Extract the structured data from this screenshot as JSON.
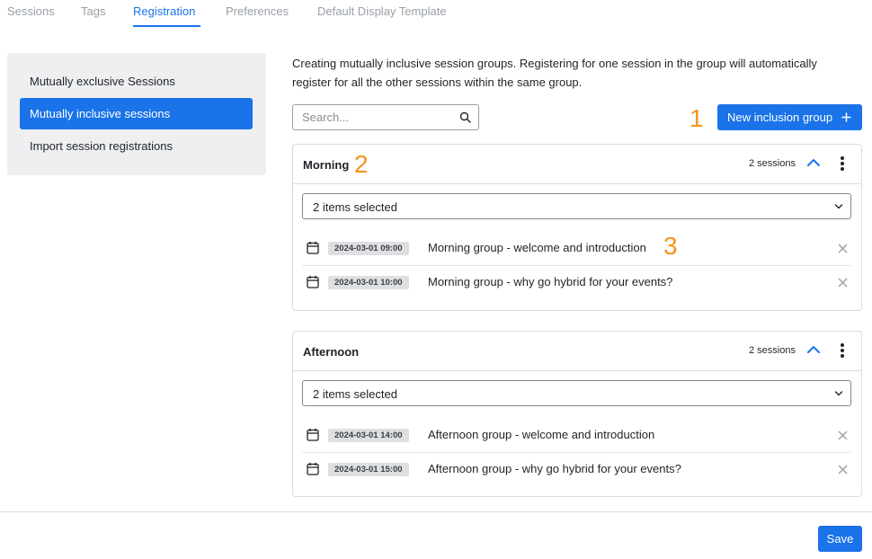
{
  "tabs": [
    {
      "label": "Sessions"
    },
    {
      "label": "Tags"
    },
    {
      "label": "Registration"
    },
    {
      "label": "Preferences"
    },
    {
      "label": "Default Display Template"
    }
  ],
  "active_tab": "Registration",
  "sidebar": {
    "items": [
      {
        "label": "Mutually exclusive Sessions"
      },
      {
        "label": "Mutually inclusive sessions"
      },
      {
        "label": "Import session registrations"
      }
    ],
    "active_item": "Mutually inclusive sessions"
  },
  "description": "Creating mutually inclusive session groups. Registering for one session in the group will automatically register for all the other sessions within the same group.",
  "search": {
    "placeholder": "Search...",
    "value": ""
  },
  "new_button_label": "New inclusion group",
  "annotations": [
    "1",
    "2",
    "3"
  ],
  "groups": [
    {
      "name": "Morning",
      "count_label": "2 sessions",
      "select_value": "2 items selected",
      "sessions": [
        {
          "date": "2024-03-01 09:00",
          "title": "Morning group - welcome and introduction"
        },
        {
          "date": "2024-03-01 10:00",
          "title": "Morning group - why go hybrid for your events?"
        }
      ]
    },
    {
      "name": "Afternoon",
      "count_label": "2 sessions",
      "select_value": "2 items selected",
      "sessions": [
        {
          "date": "2024-03-01 14:00",
          "title": "Afternoon group - welcome and introduction"
        },
        {
          "date": "2024-03-01 15:00",
          "title": "Afternoon group - why go hybrid for your events?"
        }
      ]
    }
  ],
  "save_label": "Save",
  "colors": {
    "accent": "#1a73e8",
    "annotation": "#f6921e",
    "sidebar_bg": "#eeeff1"
  }
}
